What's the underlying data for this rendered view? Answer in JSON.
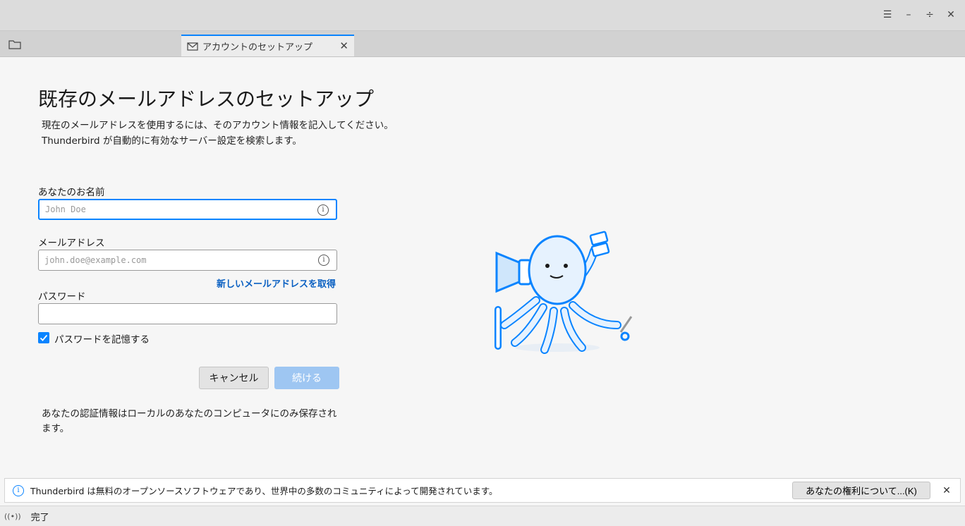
{
  "window": {
    "controls": [
      "menu-icon",
      "minimize-icon",
      "maximize-icon",
      "close-icon"
    ]
  },
  "tabs": [
    {
      "label": "アカウントのセットアップ",
      "icon": "mail-icon",
      "active": true
    }
  ],
  "accent_color": "#0a84ff",
  "main": {
    "title": "既存のメールアドレスのセットアップ",
    "subtitle_line1": "現在のメールアドレスを使用するには、そのアカウント情報を記入してください。",
    "subtitle_line2": "Thunderbird が自動的に有効なサーバー設定を検索します。",
    "name_label": "あなたのお名前",
    "name_placeholder": "John Doe",
    "email_label": "メールアドレス",
    "email_placeholder": "john.doe@example.com",
    "get_new_email_link": "新しいメールアドレスを取得",
    "password_label": "パスワード",
    "remember_password_label": "パスワードを記憶する",
    "remember_password_checked": true,
    "cancel_button": "キャンセル",
    "continue_button": "続ける",
    "storage_note": "あなたの認証情報はローカルのあなたのコンピュータにのみ保存されます。"
  },
  "notification": {
    "text": "Thunderbird は無料のオープンソースソフトウェアであり、世界中の多数のコミュニティによって開発されています。",
    "button": "あなたの権利について...(K)"
  },
  "status": {
    "text": "完了"
  }
}
